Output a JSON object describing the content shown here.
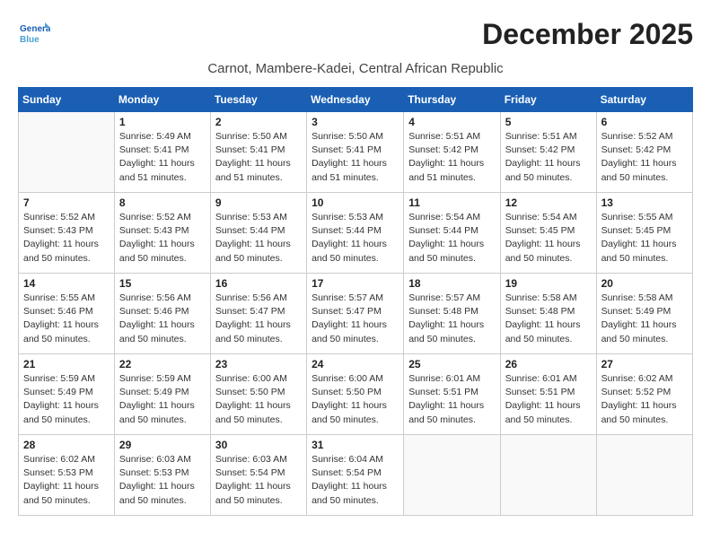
{
  "logo": {
    "line1": "General",
    "line2": "Blue"
  },
  "title": "December 2025",
  "subtitle": "Carnot, Mambere-Kadei, Central African Republic",
  "weekdays": [
    "Sunday",
    "Monday",
    "Tuesday",
    "Wednesday",
    "Thursday",
    "Friday",
    "Saturday"
  ],
  "weeks": [
    [
      {
        "day": "",
        "info": ""
      },
      {
        "day": "1",
        "info": "Sunrise: 5:49 AM\nSunset: 5:41 PM\nDaylight: 11 hours\nand 51 minutes."
      },
      {
        "day": "2",
        "info": "Sunrise: 5:50 AM\nSunset: 5:41 PM\nDaylight: 11 hours\nand 51 minutes."
      },
      {
        "day": "3",
        "info": "Sunrise: 5:50 AM\nSunset: 5:41 PM\nDaylight: 11 hours\nand 51 minutes."
      },
      {
        "day": "4",
        "info": "Sunrise: 5:51 AM\nSunset: 5:42 PM\nDaylight: 11 hours\nand 51 minutes."
      },
      {
        "day": "5",
        "info": "Sunrise: 5:51 AM\nSunset: 5:42 PM\nDaylight: 11 hours\nand 50 minutes."
      },
      {
        "day": "6",
        "info": "Sunrise: 5:52 AM\nSunset: 5:42 PM\nDaylight: 11 hours\nand 50 minutes."
      }
    ],
    [
      {
        "day": "7",
        "info": "Sunrise: 5:52 AM\nSunset: 5:43 PM\nDaylight: 11 hours\nand 50 minutes."
      },
      {
        "day": "8",
        "info": "Sunrise: 5:52 AM\nSunset: 5:43 PM\nDaylight: 11 hours\nand 50 minutes."
      },
      {
        "day": "9",
        "info": "Sunrise: 5:53 AM\nSunset: 5:44 PM\nDaylight: 11 hours\nand 50 minutes."
      },
      {
        "day": "10",
        "info": "Sunrise: 5:53 AM\nSunset: 5:44 PM\nDaylight: 11 hours\nand 50 minutes."
      },
      {
        "day": "11",
        "info": "Sunrise: 5:54 AM\nSunset: 5:44 PM\nDaylight: 11 hours\nand 50 minutes."
      },
      {
        "day": "12",
        "info": "Sunrise: 5:54 AM\nSunset: 5:45 PM\nDaylight: 11 hours\nand 50 minutes."
      },
      {
        "day": "13",
        "info": "Sunrise: 5:55 AM\nSunset: 5:45 PM\nDaylight: 11 hours\nand 50 minutes."
      }
    ],
    [
      {
        "day": "14",
        "info": "Sunrise: 5:55 AM\nSunset: 5:46 PM\nDaylight: 11 hours\nand 50 minutes."
      },
      {
        "day": "15",
        "info": "Sunrise: 5:56 AM\nSunset: 5:46 PM\nDaylight: 11 hours\nand 50 minutes."
      },
      {
        "day": "16",
        "info": "Sunrise: 5:56 AM\nSunset: 5:47 PM\nDaylight: 11 hours\nand 50 minutes."
      },
      {
        "day": "17",
        "info": "Sunrise: 5:57 AM\nSunset: 5:47 PM\nDaylight: 11 hours\nand 50 minutes."
      },
      {
        "day": "18",
        "info": "Sunrise: 5:57 AM\nSunset: 5:48 PM\nDaylight: 11 hours\nand 50 minutes."
      },
      {
        "day": "19",
        "info": "Sunrise: 5:58 AM\nSunset: 5:48 PM\nDaylight: 11 hours\nand 50 minutes."
      },
      {
        "day": "20",
        "info": "Sunrise: 5:58 AM\nSunset: 5:49 PM\nDaylight: 11 hours\nand 50 minutes."
      }
    ],
    [
      {
        "day": "21",
        "info": "Sunrise: 5:59 AM\nSunset: 5:49 PM\nDaylight: 11 hours\nand 50 minutes."
      },
      {
        "day": "22",
        "info": "Sunrise: 5:59 AM\nSunset: 5:49 PM\nDaylight: 11 hours\nand 50 minutes."
      },
      {
        "day": "23",
        "info": "Sunrise: 6:00 AM\nSunset: 5:50 PM\nDaylight: 11 hours\nand 50 minutes."
      },
      {
        "day": "24",
        "info": "Sunrise: 6:00 AM\nSunset: 5:50 PM\nDaylight: 11 hours\nand 50 minutes."
      },
      {
        "day": "25",
        "info": "Sunrise: 6:01 AM\nSunset: 5:51 PM\nDaylight: 11 hours\nand 50 minutes."
      },
      {
        "day": "26",
        "info": "Sunrise: 6:01 AM\nSunset: 5:51 PM\nDaylight: 11 hours\nand 50 minutes."
      },
      {
        "day": "27",
        "info": "Sunrise: 6:02 AM\nSunset: 5:52 PM\nDaylight: 11 hours\nand 50 minutes."
      }
    ],
    [
      {
        "day": "28",
        "info": "Sunrise: 6:02 AM\nSunset: 5:53 PM\nDaylight: 11 hours\nand 50 minutes."
      },
      {
        "day": "29",
        "info": "Sunrise: 6:03 AM\nSunset: 5:53 PM\nDaylight: 11 hours\nand 50 minutes."
      },
      {
        "day": "30",
        "info": "Sunrise: 6:03 AM\nSunset: 5:54 PM\nDaylight: 11 hours\nand 50 minutes."
      },
      {
        "day": "31",
        "info": "Sunrise: 6:04 AM\nSunset: 5:54 PM\nDaylight: 11 hours\nand 50 minutes."
      },
      {
        "day": "",
        "info": ""
      },
      {
        "day": "",
        "info": ""
      },
      {
        "day": "",
        "info": ""
      }
    ]
  ]
}
